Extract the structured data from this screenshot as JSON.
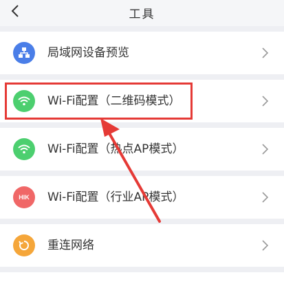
{
  "header": {
    "title": "工具",
    "back_icon": "chevron-left-icon"
  },
  "items": [
    {
      "label": "局域网设备预览",
      "icon": "lan-devices-icon",
      "icon_color": "#4a7ee8"
    },
    {
      "label": "Wi-Fi配置（二维码模式）",
      "icon": "wifi-icon",
      "icon_color": "#4ccf6f"
    },
    {
      "label": "Wi-Fi配置（热点AP模式）",
      "icon": "wifi-icon",
      "icon_color": "#4ccf6f"
    },
    {
      "label": "Wi-Fi配置（行业AP模式）",
      "icon": "hik-icon",
      "icon_text": "HIK",
      "icon_color": "#f06767"
    },
    {
      "label": "重连网络",
      "icon": "reconnect-icon",
      "icon_color": "#f5a63a"
    }
  ],
  "annotation": {
    "highlight_color": "#e53a36"
  }
}
